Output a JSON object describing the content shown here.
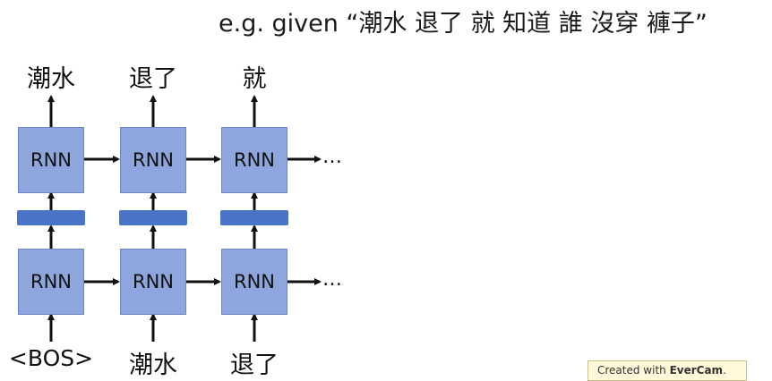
{
  "caption": "e.g. given “潮水 退了 就 知道 誰 沒穿 褲子”",
  "outputs": [
    "潮水",
    "退了",
    "就"
  ],
  "inputs": [
    "<BOS>",
    "潮水",
    "退了"
  ],
  "rnn_label": "RNN",
  "continuation": "…",
  "watermark": {
    "prefix": "Created with ",
    "brand": "EverCam",
    "suffix": "."
  },
  "colors": {
    "rnn_box": "#8ea5de",
    "bar": "#4a74c8"
  }
}
